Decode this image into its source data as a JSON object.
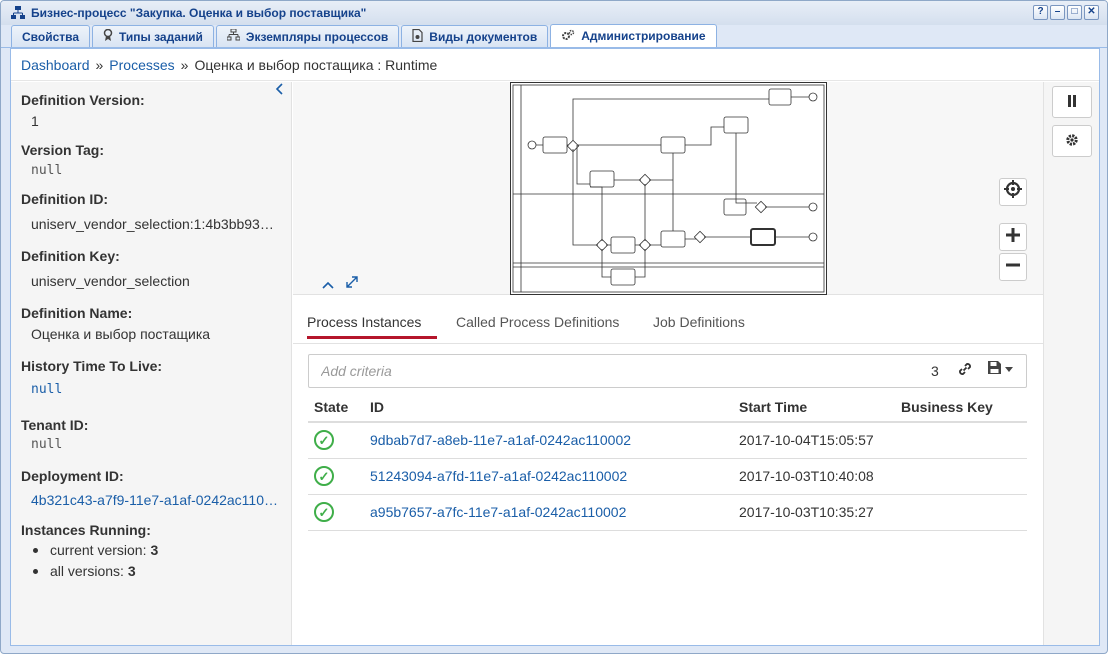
{
  "window": {
    "title": "Бизнес-процесс \"Закупка. Оценка и выбор поставщика\"",
    "buttons": [
      "?",
      "–",
      "□",
      "✕"
    ]
  },
  "tabs": [
    {
      "label": "Свойства",
      "icon": ""
    },
    {
      "label": "Типы заданий",
      "icon": "ribbon-icon"
    },
    {
      "label": "Экземпляры процессов",
      "icon": "sitemap-icon"
    },
    {
      "label": "Виды документов",
      "icon": "document-icon"
    },
    {
      "label": "Администрирование",
      "icon": "gears-icon",
      "active": true
    }
  ],
  "breadcrumb": {
    "dashboard": "Dashboard",
    "sep1": "»",
    "processes": "Processes",
    "sep2": "»",
    "current": "Оценка и выбор постащика : Runtime"
  },
  "sidebar": {
    "definition_version_label": "Definition Version:",
    "definition_version": "1",
    "version_tag_label": "Version Tag:",
    "version_tag": "null",
    "definition_id_label": "Definition ID:",
    "definition_id": "uniserv_vendor_selection:1:4b3bb93…",
    "definition_key_label": "Definition Key:",
    "definition_key": "uniserv_vendor_selection",
    "definition_name_label": "Definition Name:",
    "definition_name": "Оценка и выбор постащика",
    "history_ttl_label": "History Time To Live:",
    "history_ttl": "null",
    "tenant_id_label": "Tenant ID:",
    "tenant_id": "null",
    "deployment_id_label": "Deployment ID:",
    "deployment_id": "4b321c43-a7f9-11e7-a1af-0242ac110…",
    "instances_running_label": "Instances Running:",
    "current_version_label": "current version:",
    "current_version": "3",
    "all_versions_label": "all versions:",
    "all_versions": "3"
  },
  "detail_tabs": {
    "process_instances": "Process Instances",
    "called_definitions": "Called Process Definitions",
    "job_definitions": "Job Definitions"
  },
  "search": {
    "placeholder": "Add criteria",
    "count": "3"
  },
  "table": {
    "headers": {
      "state": "State",
      "id": "ID",
      "start_time": "Start Time",
      "business_key": "Business Key"
    },
    "rows": [
      {
        "id": "9dbab7d7-a8eb-11e7-a1af-0242ac110002",
        "start_time": "2017-10-04T15:05:57",
        "business_key": ""
      },
      {
        "id": "51243094-a7fd-11e7-a1af-0242ac110002",
        "start_time": "2017-10-03T10:40:08",
        "business_key": ""
      },
      {
        "id": "a95b7657-a7fc-11e7-a1af-0242ac110002",
        "start_time": "2017-10-03T10:35:27",
        "business_key": ""
      }
    ]
  },
  "colors": {
    "link": "#1a5ea8",
    "active_tab_underline": "#b5152b",
    "ok": "#3fae49",
    "title_text": "#15428b"
  }
}
